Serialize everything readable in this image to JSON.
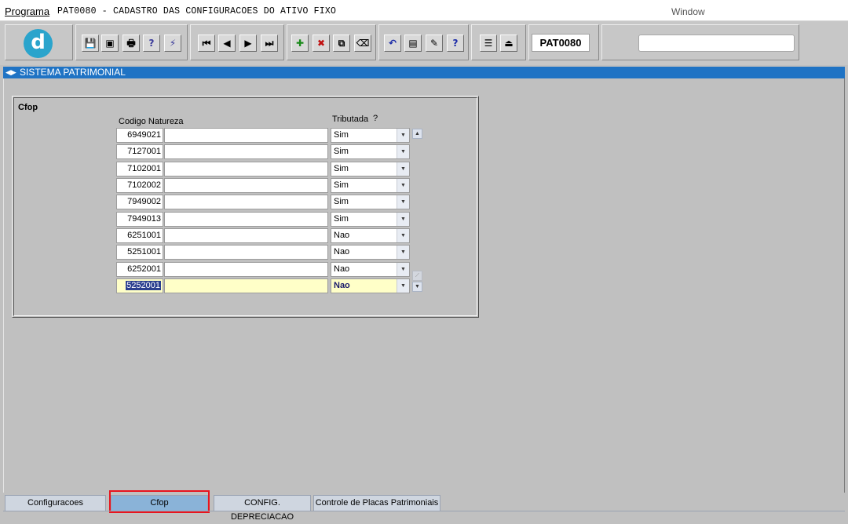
{
  "menubar": {
    "programa": "Programa",
    "title": "PAT0080 - CADASTRO DAS CONFIGURACOES DO ATIVO FIXO",
    "window": "Window"
  },
  "toolbar": {
    "logo_letter": "d",
    "form_code": "PAT0080",
    "status_value": "",
    "buttons": [
      {
        "name": "save",
        "glyph": "💾"
      },
      {
        "name": "print-screen",
        "glyph": "▣"
      },
      {
        "name": "printer",
        "glyph": "🖶"
      },
      {
        "name": "query",
        "glyph": "?"
      },
      {
        "name": "execute-query",
        "glyph": "⚡"
      },
      {
        "name": "first-record",
        "glyph": "⏮"
      },
      {
        "name": "previous-record",
        "glyph": "◀"
      },
      {
        "name": "next-record",
        "glyph": "▶"
      },
      {
        "name": "last-record",
        "glyph": "⏭"
      },
      {
        "name": "insert-record",
        "glyph": "✚"
      },
      {
        "name": "delete-record",
        "glyph": "✖"
      },
      {
        "name": "duplicate-record",
        "glyph": "⧉"
      },
      {
        "name": "clear-record",
        "glyph": "⌫"
      },
      {
        "name": "undo",
        "glyph": "↶"
      },
      {
        "name": "list-values",
        "glyph": "▤"
      },
      {
        "name": "edit-field",
        "glyph": "✎"
      },
      {
        "name": "help",
        "glyph": "?"
      },
      {
        "name": "menu",
        "glyph": "☰"
      },
      {
        "name": "exit",
        "glyph": "⏏"
      }
    ]
  },
  "sysbar": {
    "label": "SISTEMA PATRIMONIAL"
  },
  "panel": {
    "title": "Cfop",
    "col_codigo_natureza": "Codigo Natureza",
    "col_tributada": "Tributada",
    "col_help": "?",
    "rows": [
      {
        "codigo": "6949021",
        "natureza": "",
        "tributada": "Sim"
      },
      {
        "codigo": "7127001",
        "natureza": "",
        "tributada": "Sim"
      },
      {
        "codigo": "7102001",
        "natureza": "",
        "tributada": "Sim"
      },
      {
        "codigo": "7102002",
        "natureza": "",
        "tributada": "Sim"
      },
      {
        "codigo": "7949002",
        "natureza": "",
        "tributada": "Sim"
      },
      {
        "codigo": "7949013",
        "natureza": "",
        "tributada": "Sim"
      },
      {
        "codigo": "6251001",
        "natureza": "",
        "tributada": "Nao"
      },
      {
        "codigo": "5251001",
        "natureza": "",
        "tributada": "Nao"
      },
      {
        "codigo": "6252001",
        "natureza": "",
        "tributada": "Nao"
      },
      {
        "codigo": "5252001",
        "natureza": "",
        "tributada": "Nao"
      }
    ],
    "current_row": 9
  },
  "tabs": [
    {
      "label": "Configuracoes",
      "active": false
    },
    {
      "label": "Cfop",
      "active": true
    },
    {
      "label": "CONFIG. DEPRECIACAO",
      "active": false
    },
    {
      "label": "Controle de Placas Patrimoniais",
      "active": false
    }
  ],
  "colors": {
    "sysbar": "#1f73c4",
    "active_tab": "#8ab3d8",
    "current_row": "#ffffc8",
    "selection": "#2b3f8f",
    "tab_highlight": "#e8141e"
  }
}
